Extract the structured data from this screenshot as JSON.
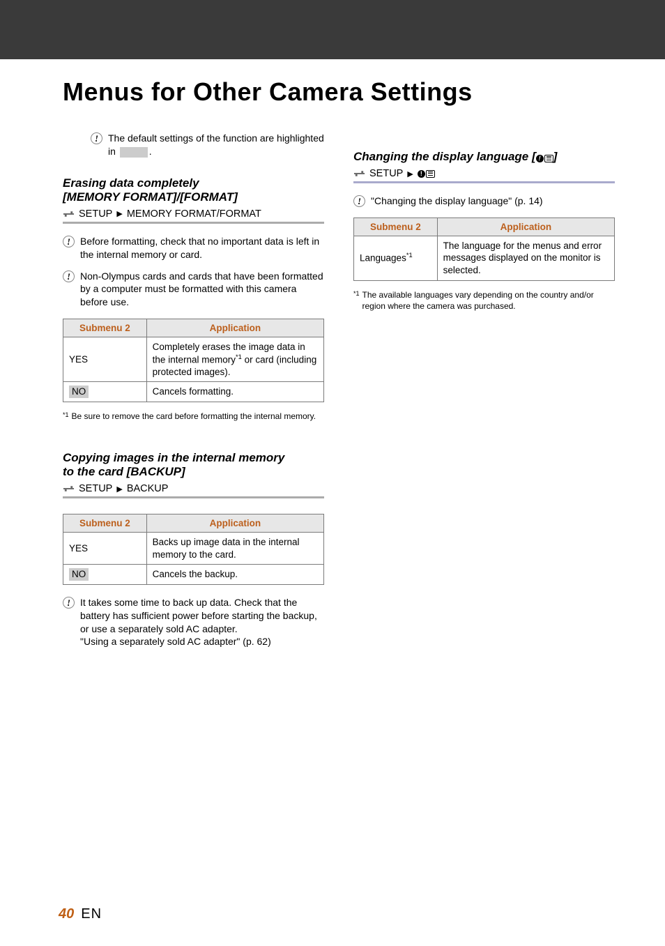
{
  "page": {
    "title": "Menus for Other Camera Settings",
    "intro_note": "The default settings of the function are highlighted in ",
    "intro_note_end": "."
  },
  "left": {
    "sec1": {
      "title_line1": "Erasing data completely",
      "title_line2": "[MEMORY FORMAT]/[FORMAT]",
      "path_setup": "SETUP",
      "path_item": "MEMORY FORMAT/FORMAT",
      "note1": "Before formatting, check that no important data is left in the internal memory or card.",
      "note2": "Non-Olympus cards and cards that have been formatted by a computer must be formatted with this camera before use.",
      "table": {
        "h1": "Submenu 2",
        "h2": "Application",
        "r1c1": "YES",
        "r1c2a": "Completely erases the image data in the internal memory",
        "r1c2_sup": "*1",
        "r1c2b": " or card (including protected images).",
        "r2c1": "NO",
        "r2c2": "Cancels formatting."
      },
      "foot_sup": "*1",
      "foot": "Be sure to remove the card before formatting the internal memory."
    },
    "sec2": {
      "title_line1": "Copying images in the internal memory",
      "title_line2": "to the card [BACKUP]",
      "path_setup": "SETUP",
      "path_item": "BACKUP",
      "table": {
        "h1": "Submenu 2",
        "h2": "Application",
        "r1c1": "YES",
        "r1c2": "Backs up image data in the internal memory to the card.",
        "r2c1": "NO",
        "r2c2": "Cancels the backup."
      },
      "note_a": "It takes some time to back up data. Check that the battery has sufficient power before starting the backup, or use a separately sold AC adapter.",
      "note_b": "\"Using a separately sold AC adapter\" (p. 62)"
    }
  },
  "right": {
    "sec1": {
      "title": "Changing the display language [",
      "title_end": "]",
      "path_setup": "SETUP",
      "note": "\"Changing the display language\" (p. 14)",
      "table": {
        "h1": "Submenu 2",
        "h2": "Application",
        "r1c1a": "Languages",
        "r1c1_sup": "*1",
        "r1c2": "The language for the menus and error messages displayed on the monitor is selected."
      },
      "foot_sup": "*1",
      "foot": "The available languages vary depending on the country and/or region where the camera was purchased."
    }
  },
  "footer": {
    "page_num": "40",
    "lang": "EN"
  }
}
